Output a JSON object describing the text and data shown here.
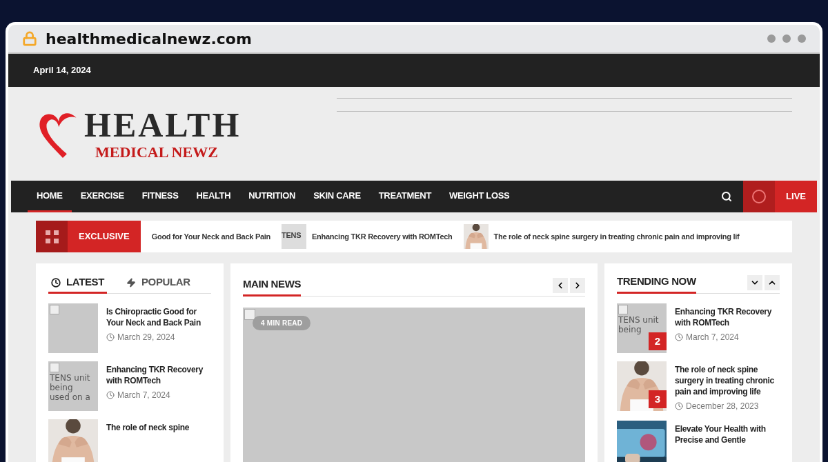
{
  "browser": {
    "url": "healthmedicalnewz.com"
  },
  "top_bar": {
    "date": "April 14, 2024"
  },
  "logo": {
    "line1": "HEALTH",
    "line2": "MEDICAL NEWZ"
  },
  "nav": {
    "items": [
      {
        "label": "HOME",
        "selected": true
      },
      {
        "label": "EXERCISE",
        "selected": false
      },
      {
        "label": "FITNESS",
        "selected": false
      },
      {
        "label": "HEALTH",
        "selected": false
      },
      {
        "label": "NUTRITION",
        "selected": false
      },
      {
        "label": "SKIN CARE",
        "selected": false
      },
      {
        "label": "TREATMENT",
        "selected": false
      },
      {
        "label": "WEIGHT LOSS",
        "selected": false
      }
    ],
    "live": "LIVE"
  },
  "ticker": {
    "label": "EXCLUSIVE",
    "items": [
      {
        "title": "Good for Your Neck and Back Pain"
      },
      {
        "title": "Enhancing TKR Recovery with ROMTech",
        "kind": "broken",
        "alt": "TENS"
      },
      {
        "title": "The role of neck spine surgery in treating chronic pain and improving lif"
      }
    ]
  },
  "left_panel": {
    "tabs": [
      {
        "label": "LATEST",
        "kind": "clock",
        "selected": true
      },
      {
        "label": "POPULAR",
        "kind": "bolt",
        "selected": false
      }
    ],
    "posts": [
      {
        "title": "Is Chiropractic Good for Your Neck and Back Pain",
        "date": "March 29, 2024",
        "kind": "broken"
      },
      {
        "title": "Enhancing TKR Recovery with ROMTech",
        "date": "March 7, 2024",
        "kind": "broken",
        "alt": "TENS unit being used on a"
      },
      {
        "title": "The role of neck spine"
      }
    ]
  },
  "main_news": {
    "title": "MAIN NEWS",
    "badge": "4 MIN READ"
  },
  "trending": {
    "title": "TRENDING NOW",
    "posts": [
      {
        "title": "Enhancing TKR Recovery with ROMTech",
        "date": "March 7, 2024",
        "rank": "2",
        "kind": "broken",
        "alt": "TENS unit being"
      },
      {
        "title": "The role of neck spine surgery in treating chronic pain and improving life",
        "date": "December 28, 2023",
        "rank": "3"
      },
      {
        "title": "Elevate Your Health with Precise and Gentle",
        "kind": "tech"
      }
    ]
  }
}
